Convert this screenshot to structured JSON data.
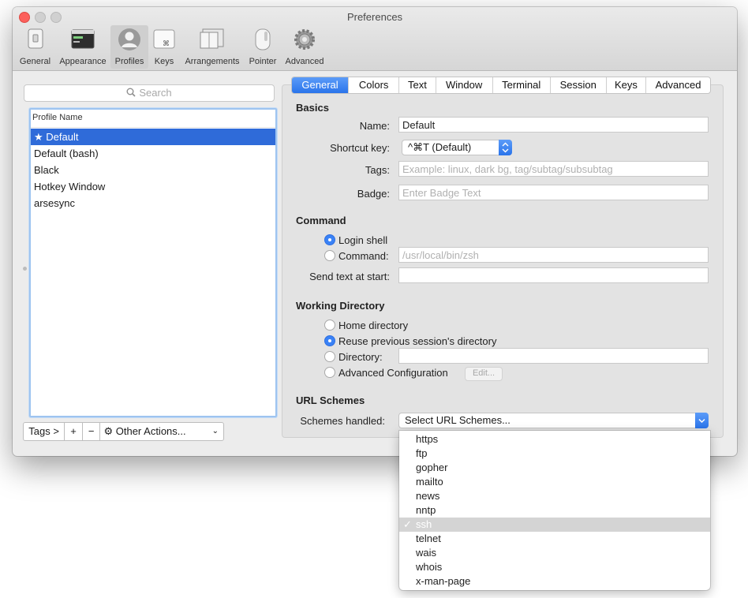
{
  "window": {
    "title": "Preferences"
  },
  "toolbar": [
    {
      "id": "general",
      "label": "General",
      "icon": "phone-switch-icon"
    },
    {
      "id": "appearance",
      "label": "Appearance",
      "icon": "terminal-window-icon"
    },
    {
      "id": "profiles",
      "label": "Profiles",
      "icon": "user-silhouette-icon",
      "selected": true
    },
    {
      "id": "keys",
      "label": "Keys",
      "icon": "command-key-icon"
    },
    {
      "id": "arrangements",
      "label": "Arrangements",
      "icon": "window-arrangement-icon"
    },
    {
      "id": "pointer",
      "label": "Pointer",
      "icon": "mouse-icon"
    },
    {
      "id": "advanced",
      "label": "Advanced",
      "icon": "gear-icon"
    }
  ],
  "profiles": {
    "search_placeholder": "Search",
    "column_header": "Profile Name",
    "items": [
      {
        "label": "★ Default",
        "selected": true
      },
      {
        "label": "Default (bash)"
      },
      {
        "label": "Black"
      },
      {
        "label": "Hotkey Window"
      },
      {
        "label": "arsesync"
      }
    ],
    "tags_button": "Tags >",
    "add_button": "+",
    "remove_button": "−",
    "other_actions": "Other Actions..."
  },
  "tabs": [
    "General",
    "Colors",
    "Text",
    "Window",
    "Terminal",
    "Session",
    "Keys",
    "Advanced"
  ],
  "selected_tab": "General",
  "basics": {
    "heading": "Basics",
    "name_label": "Name:",
    "name_value": "Default",
    "shortcut_label": "Shortcut key:",
    "shortcut_value": "^⌘T (Default)",
    "tags_label": "Tags:",
    "tags_placeholder": "Example: linux, dark bg, tag/subtag/subsubtag",
    "badge_label": "Badge:",
    "badge_placeholder": "Enter Badge Text"
  },
  "command": {
    "heading": "Command",
    "login_shell": "Login shell",
    "command_label": "Command:",
    "command_placeholder": "/usr/local/bin/zsh",
    "send_text_label": "Send text at start:",
    "send_text_value": ""
  },
  "working_directory": {
    "heading": "Working Directory",
    "home": "Home directory",
    "reuse": "Reuse previous session's directory",
    "directory": "Directory:",
    "directory_value": "",
    "advanced": "Advanced Configuration",
    "edit_button": "Edit..."
  },
  "url_schemes": {
    "heading": "URL Schemes",
    "label": "Schemes handled:",
    "popup_value": "Select URL Schemes...",
    "options": [
      "https",
      "ftp",
      "gopher",
      "mailto",
      "news",
      "nntp",
      "ssh",
      "telnet",
      "wais",
      "whois",
      "x-man-page"
    ],
    "checked": "ssh",
    "check_mark": "✓"
  },
  "colors": {
    "accent": "#2f6bd9",
    "tab_selected": "#3b82f6",
    "close_button": "#fc605c"
  }
}
